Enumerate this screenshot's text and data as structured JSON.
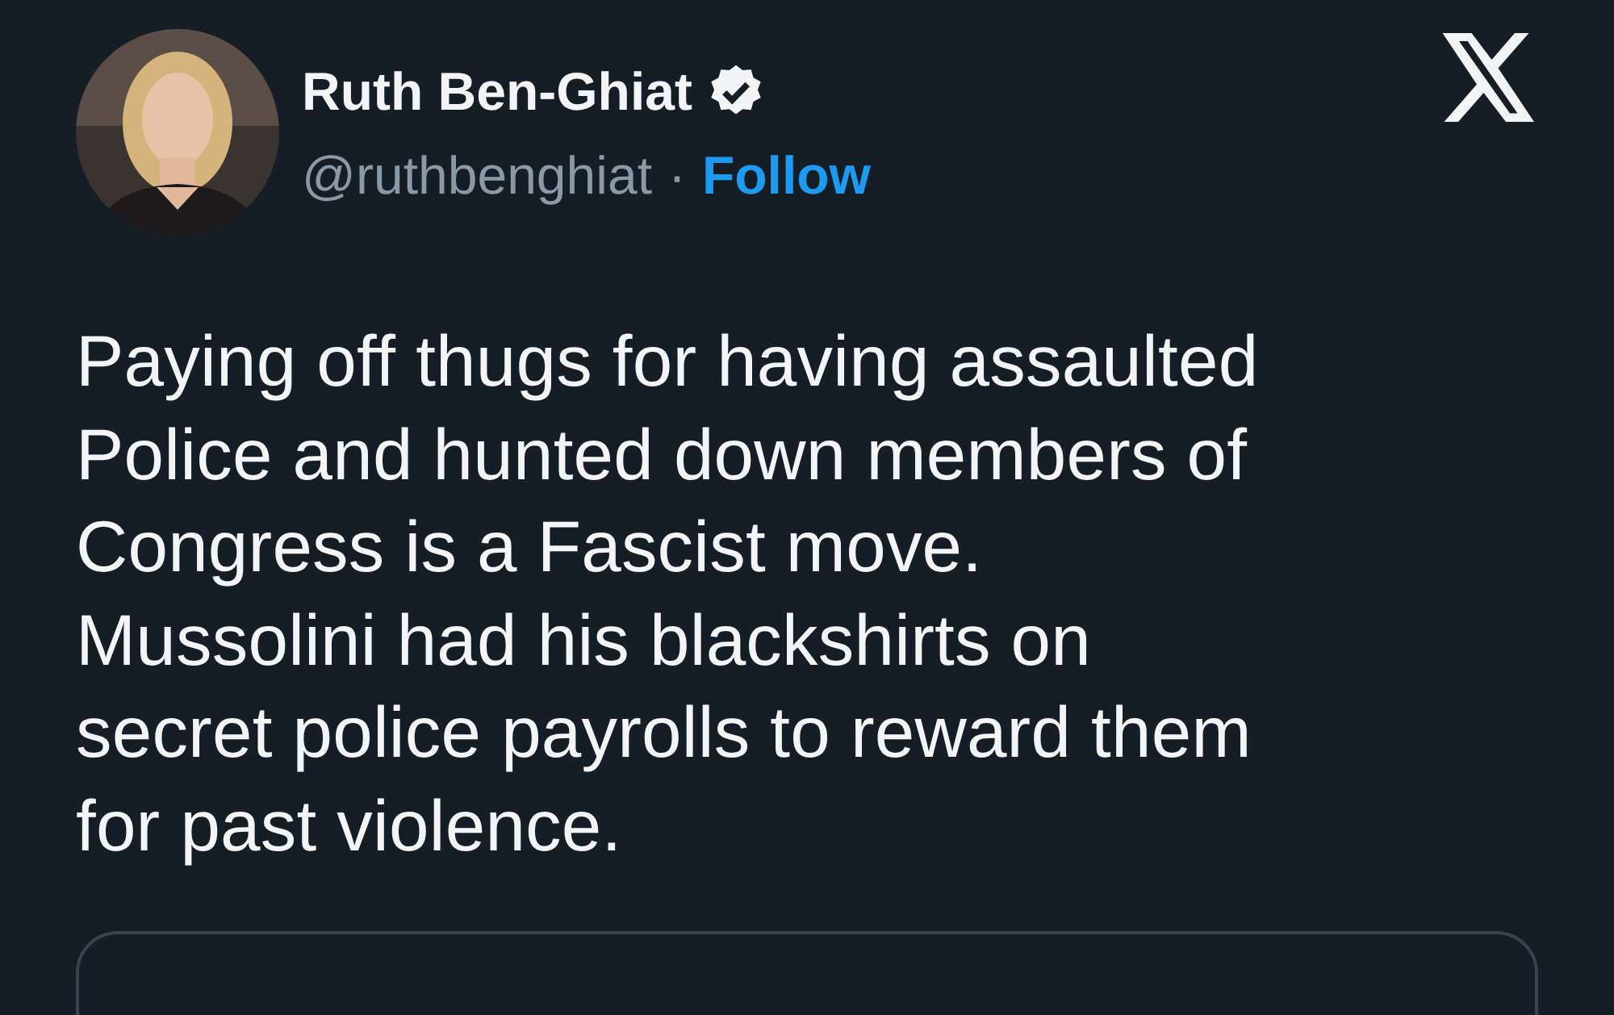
{
  "author": {
    "name": "Ruth Ben-Ghiat",
    "verified": true,
    "handle": "@ruthbenghiat",
    "separator": "·",
    "follow": "Follow"
  },
  "text": "Paying off thugs for having assaulted\nPolice and hunted down members of\nCongress is a Fascist move.\nMussolini had his blackshirts on\nsecret police payrolls to reward them\nfor past violence.",
  "card": {
    "kind": "outline"
  }
}
